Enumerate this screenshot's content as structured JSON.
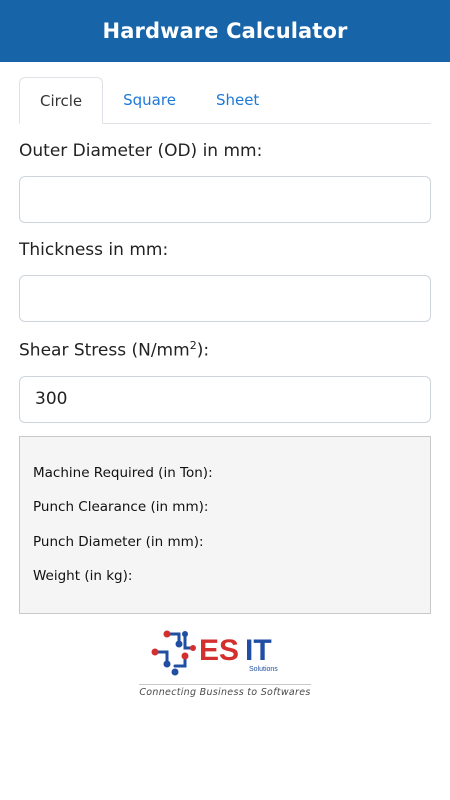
{
  "app": {
    "title": "Hardware Calculator"
  },
  "tabs": [
    {
      "label": "Circle",
      "active": true
    },
    {
      "label": "Square",
      "active": false
    },
    {
      "label": "Sheet",
      "active": false
    }
  ],
  "form": {
    "od_label": "Outer Diameter (OD) in mm:",
    "od_value": "",
    "thickness_label": "Thickness in mm:",
    "thickness_value": "",
    "shear_label_prefix": "Shear Stress (N/mm",
    "shear_label_sup": "2",
    "shear_label_suffix": "):",
    "shear_value": "300"
  },
  "results": {
    "machine_required": "Machine Required (in Ton):",
    "punch_clearance": "Punch Clearance (in mm):",
    "punch_diameter": "Punch Diameter (in mm):",
    "weight": "Weight (in kg):"
  },
  "logo": {
    "brand_text": "ESIT",
    "sub_text": "Solutions",
    "tagline": "Connecting Business to Softwares",
    "colors": {
      "red": "#d32f2f",
      "blue": "#1f4ea3"
    }
  },
  "colors": {
    "appbar": "#1864a8",
    "tab_link": "#1e78d6",
    "results_bg": "#f5f5f5"
  }
}
